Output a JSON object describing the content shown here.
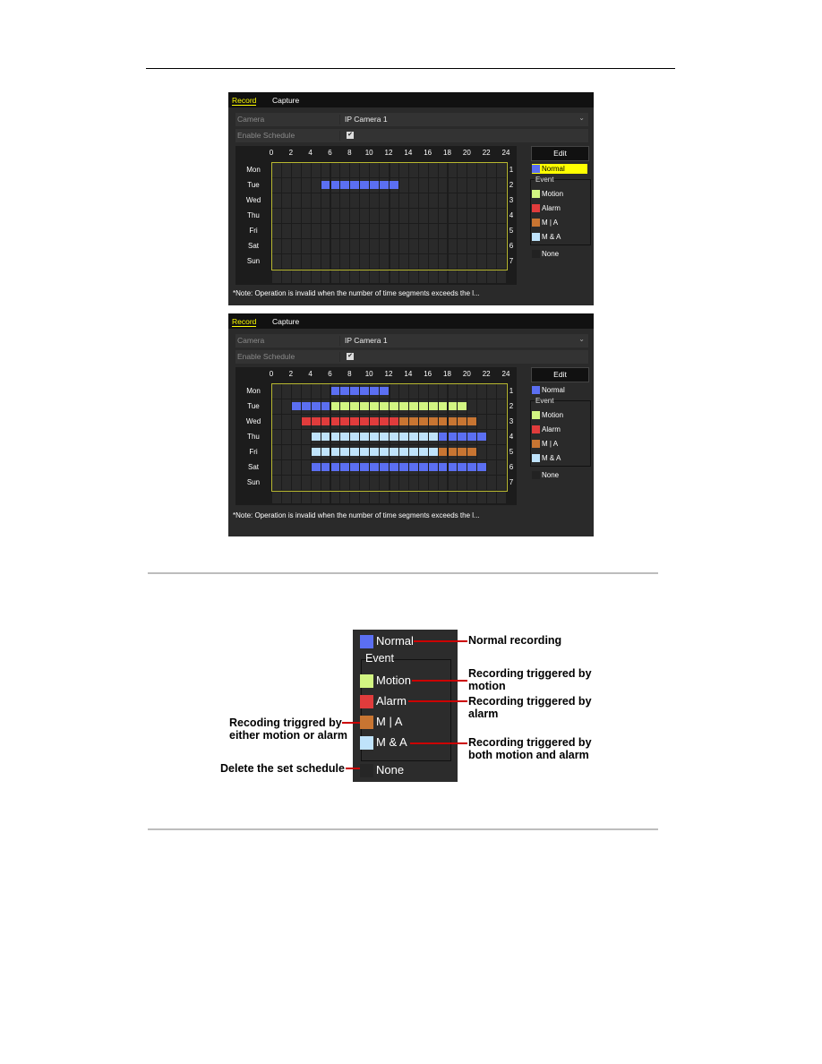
{
  "colors": {
    "normal": "#5b6ff2",
    "motion": "#d2f582",
    "alarm": "#e03c3c",
    "m_or_a": "#c87532",
    "m_and_a": "#bfe3fb",
    "none": "#2a2a2a",
    "active_tab": "#ffff00",
    "grid_border": "#b8b830",
    "callout_line": "#cc0000"
  },
  "screenshots": [
    {
      "tabs": [
        "Record",
        "Capture"
      ],
      "active_tab": 0,
      "camera_label": "Camera",
      "camera_value": "IP Camera 1",
      "enable_label": "Enable Schedule",
      "enable_checked": true,
      "hours": [
        "0",
        "2",
        "4",
        "6",
        "8",
        "10",
        "12",
        "14",
        "16",
        "18",
        "20",
        "22",
        "24"
      ],
      "days": [
        "Mon",
        "Tue",
        "Wed",
        "Thu",
        "Fri",
        "Sat",
        "Sun"
      ],
      "row_numbers": [
        "1",
        "2",
        "3",
        "4",
        "5",
        "6",
        "7"
      ],
      "edit_label": "Edit",
      "legend": {
        "normal": "Normal",
        "event": "Event",
        "motion": "Motion",
        "alarm": "Alarm",
        "m_or_a": "M | A",
        "m_and_a": "M & A",
        "none": "None"
      },
      "selected_type": "normal",
      "note": "*Note: Operation is invalid when the number of time segments exceeds the l...",
      "schedule": [
        {
          "day": "Tue",
          "type": "normal",
          "start": 5,
          "end": 13
        }
      ]
    },
    {
      "tabs": [
        "Record",
        "Capture"
      ],
      "active_tab": 0,
      "camera_label": "Camera",
      "camera_value": "IP Camera 1",
      "enable_label": "Enable Schedule",
      "enable_checked": true,
      "hours": [
        "0",
        "2",
        "4",
        "6",
        "8",
        "10",
        "12",
        "14",
        "16",
        "18",
        "20",
        "22",
        "24"
      ],
      "days": [
        "Mon",
        "Tue",
        "Wed",
        "Thu",
        "Fri",
        "Sat",
        "Sun"
      ],
      "row_numbers": [
        "1",
        "2",
        "3",
        "4",
        "5",
        "6",
        "7"
      ],
      "edit_label": "Edit",
      "legend": {
        "normal": "Normal",
        "event": "Event",
        "motion": "Motion",
        "alarm": "Alarm",
        "m_or_a": "M | A",
        "m_and_a": "M & A",
        "none": "None"
      },
      "selected_type": "",
      "note": "*Note: Operation is invalid when the number of time segments exceeds the l...",
      "schedule": [
        {
          "day": "Mon",
          "type": "normal",
          "start": 6,
          "end": 12
        },
        {
          "day": "Tue",
          "type": "normal",
          "start": 2,
          "end": 6
        },
        {
          "day": "Tue",
          "type": "motion",
          "start": 6,
          "end": 20
        },
        {
          "day": "Wed",
          "type": "alarm",
          "start": 3,
          "end": 13
        },
        {
          "day": "Wed",
          "type": "m_or_a",
          "start": 13,
          "end": 21
        },
        {
          "day": "Thu",
          "type": "m_and_a",
          "start": 4,
          "end": 17
        },
        {
          "day": "Thu",
          "type": "normal",
          "start": 17,
          "end": 22
        },
        {
          "day": "Fri",
          "type": "m_and_a",
          "start": 4,
          "end": 17
        },
        {
          "day": "Fri",
          "type": "m_or_a",
          "start": 17,
          "end": 21
        },
        {
          "day": "Sat",
          "type": "normal",
          "start": 4,
          "end": 22
        }
      ]
    }
  ],
  "legend_callout": {
    "items": {
      "normal": "Normal",
      "event": "Event",
      "motion": "Motion",
      "alarm": "Alarm",
      "m_or_a": "M | A",
      "m_and_a": "M & A",
      "none": "None"
    },
    "captions": {
      "normal": "Normal recording",
      "motion": "Recording triggered by motion",
      "alarm": "Recording triggered by alarm",
      "m_or_a": "Recoding triggred by either motion or alarm",
      "m_and_a": "Recording triggered by both motion and alarm",
      "none": "Delete the set schedule"
    }
  }
}
